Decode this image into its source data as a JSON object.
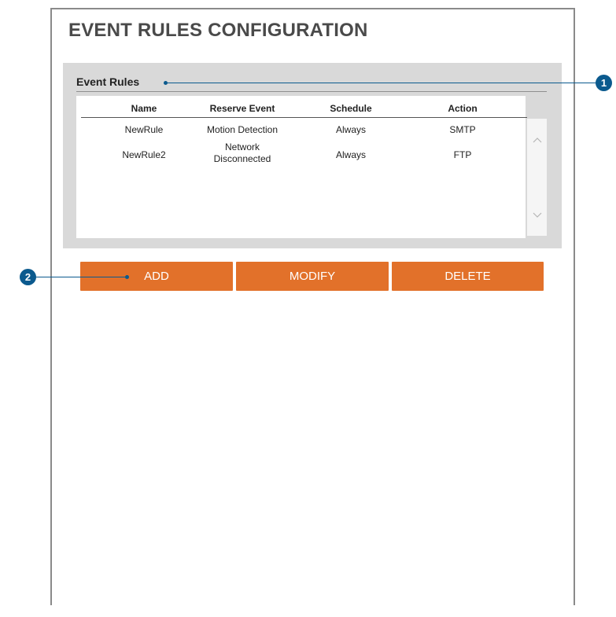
{
  "page": {
    "title": "EVENT RULES CONFIGURATION"
  },
  "event_rules": {
    "section_title": "Event Rules",
    "columns": [
      "Name",
      "Reserve Event",
      "Schedule",
      "Action"
    ],
    "rows": [
      {
        "name": "NewRule",
        "event_line1": "Motion Detection",
        "event_line2": "",
        "schedule": "Always",
        "action": "SMTP"
      },
      {
        "name": "NewRule2",
        "event_line1": "Network",
        "event_line2": "Disconnected",
        "schedule": "Always",
        "action": "FTP"
      }
    ]
  },
  "buttons": {
    "add": "ADD",
    "modify": "MODIFY",
    "delete": "DELETE"
  },
  "callouts": {
    "one": "1",
    "two": "2"
  },
  "icons": {
    "scroll_up": "chevron-up-icon",
    "scroll_down": "chevron-down-icon"
  },
  "colors": {
    "accent": "#e2712a",
    "callout": "#0b5a8e",
    "section_bg": "#d9d9d9"
  }
}
